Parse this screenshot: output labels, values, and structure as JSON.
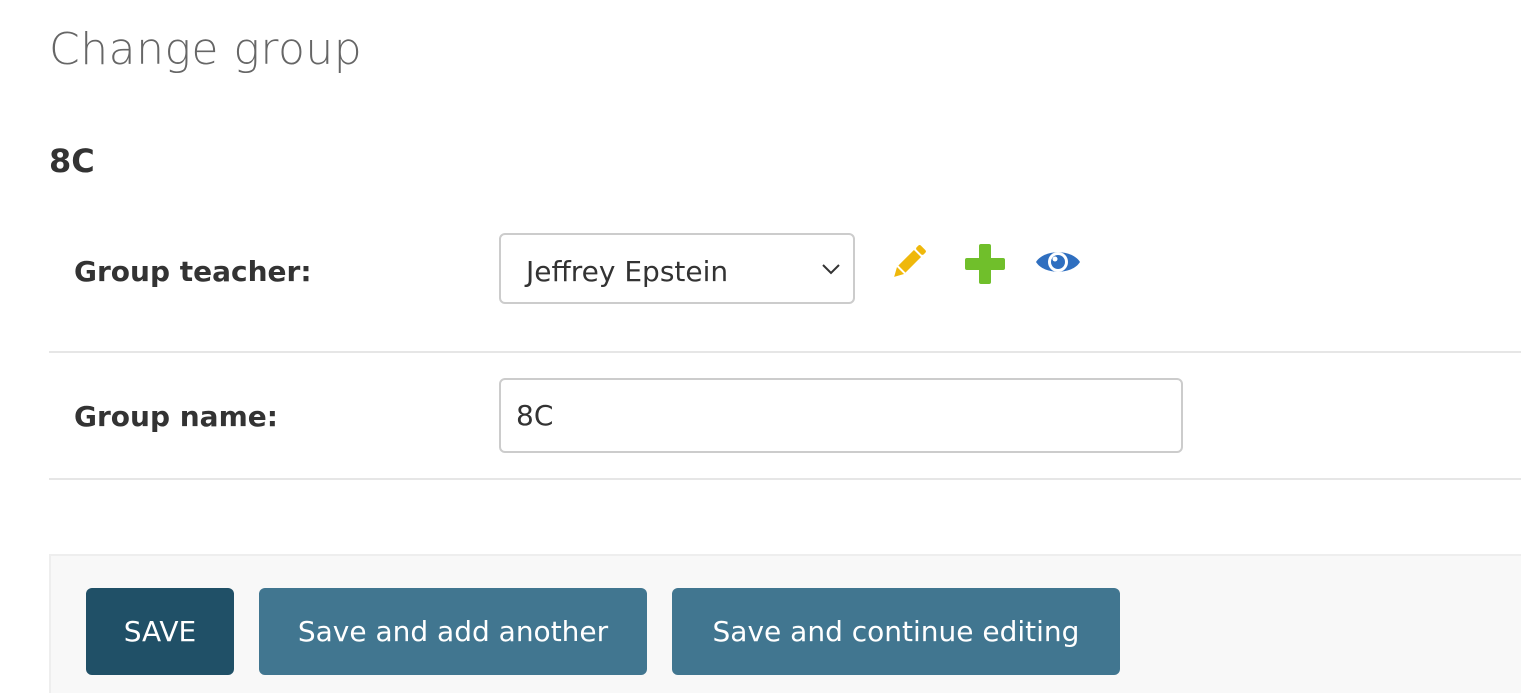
{
  "page": {
    "title": "Change group",
    "object_title": "8C"
  },
  "form": {
    "teacher": {
      "label": "Group teacher:",
      "selected": "Jeffrey Epstein",
      "actions": {
        "edit_icon": "pencil-icon",
        "add_icon": "plus-icon",
        "view_icon": "eye-icon"
      }
    },
    "name": {
      "label": "Group name:",
      "value": "8C"
    }
  },
  "buttons": {
    "save": "SAVE",
    "save_add_another": "Save and add another",
    "save_continue": "Save and continue editing"
  },
  "colors": {
    "save_button": "#205067",
    "secondary_button": "#417690",
    "edit_icon": "#efb80b",
    "add_icon": "#70bf2b",
    "view_icon": "#2f6fc0"
  }
}
